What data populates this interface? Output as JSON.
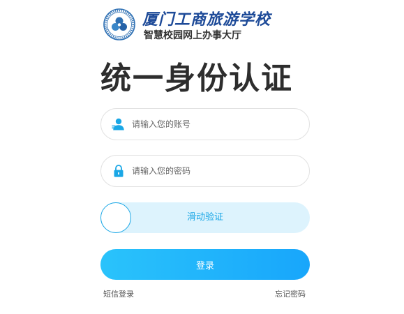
{
  "header": {
    "school_name": "厦门工商旅游学校",
    "subtitle": "智慧校园网上办事大厅"
  },
  "title": "统一身份认证",
  "form": {
    "username": {
      "placeholder": "请输入您的账号",
      "value": "",
      "icon": "user-icon"
    },
    "password": {
      "placeholder": "请输入您的密码",
      "value": "",
      "icon": "lock-icon"
    },
    "slider": {
      "label": "滑动验证",
      "progress": 0
    },
    "login_label": "登录"
  },
  "links": {
    "sms_login": "短信登录",
    "forgot_password": "忘记密码"
  },
  "colors": {
    "accent": "#1aa7e6",
    "button_start": "#2ac3fb",
    "button_end": "#18a6fb",
    "slider_bg": "#ddf3fd",
    "brand_blue": "#1d4a98",
    "title": "#2d2d2d"
  }
}
